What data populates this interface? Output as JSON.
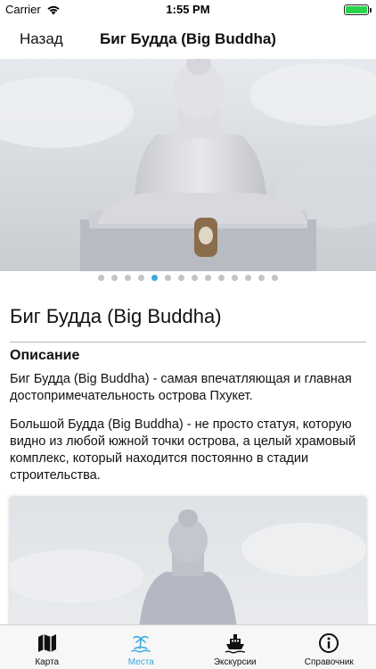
{
  "status": {
    "carrier": "Carrier",
    "time": "1:55 PM"
  },
  "nav": {
    "back_label": "Назад",
    "title": "Биг Будда (Big Buddha)"
  },
  "gallery": {
    "total": 14,
    "active_index": 4
  },
  "content": {
    "title": "Биг Будда (Big Buddha)",
    "section_title": "Описание",
    "paragraph1": "Биг Будда (Big Buddha) - самая впечатляющая и главная достопримечательность острова Пхукет.",
    "paragraph2": "Большой Будда (Big Buddha) - не просто статуя, которую видно из любой южной точки острова, а целый храмовый комплекс, который находится постоянно в стадии строительства."
  },
  "tabs": [
    {
      "label": "Карта",
      "icon": "map-icon"
    },
    {
      "label": "Места",
      "icon": "palm-island-icon"
    },
    {
      "label": "Экскурсии",
      "icon": "ship-icon"
    },
    {
      "label": "Справочник",
      "icon": "info-icon"
    }
  ],
  "colors": {
    "accent": "#3aa9e0",
    "battery": "#2bd44f"
  }
}
